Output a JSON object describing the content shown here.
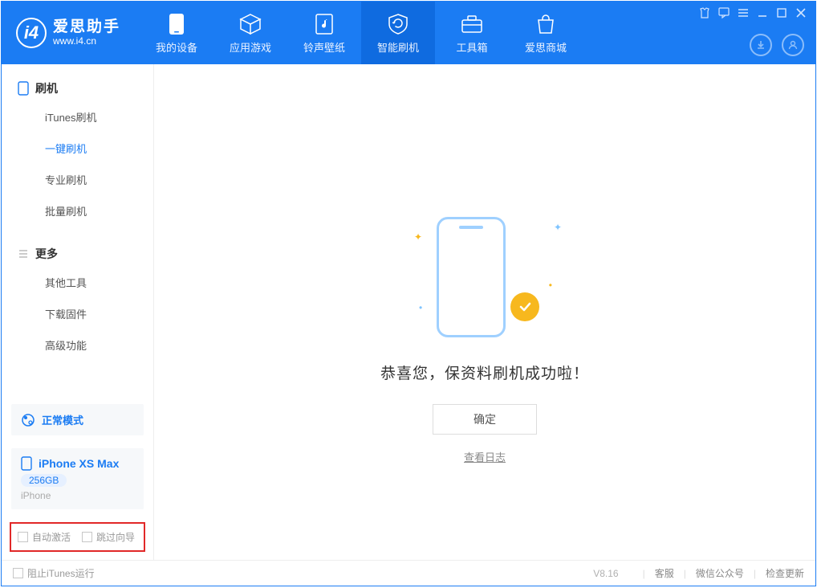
{
  "app": {
    "name_cn": "爱思助手",
    "url": "www.i4.cn"
  },
  "nav": {
    "device": "我的设备",
    "apps": "应用游戏",
    "ringtone": "铃声壁纸",
    "flash": "智能刷机",
    "toolbox": "工具箱",
    "store": "爱思商城"
  },
  "sidebar": {
    "group_flash": "刷机",
    "item_itunes": "iTunes刷机",
    "item_oneclick": "一键刷机",
    "item_pro": "专业刷机",
    "item_batch": "批量刷机",
    "group_more": "更多",
    "item_other": "其他工具",
    "item_download": "下载固件",
    "item_advanced": "高级功能"
  },
  "device": {
    "mode": "正常模式",
    "name": "iPhone XS Max",
    "storage": "256GB",
    "type": "iPhone"
  },
  "options": {
    "auto_activate": "自动激活",
    "skip_guide": "跳过向导"
  },
  "main": {
    "headline": "恭喜您，保资料刷机成功啦！",
    "ok": "确定",
    "view_log": "查看日志"
  },
  "footer": {
    "block_itunes": "阻止iTunes运行",
    "version": "V8.16",
    "support": "客服",
    "wechat": "微信公众号",
    "update": "检查更新"
  }
}
